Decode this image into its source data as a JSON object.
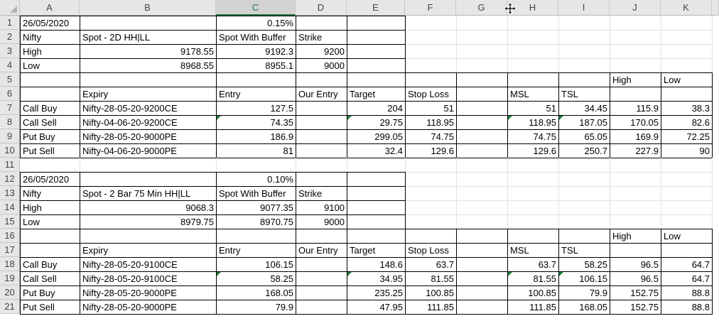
{
  "sheet": {
    "columns": [
      "A",
      "B",
      "C",
      "D",
      "E",
      "F",
      "G",
      "H",
      "I",
      "J",
      "K"
    ],
    "selected_column": "C",
    "rows": [
      "1",
      "2",
      "3",
      "4",
      "5",
      "6",
      "7",
      "8",
      "9",
      "10",
      "11",
      "12",
      "13",
      "14",
      "15",
      "16",
      "17",
      "18",
      "19",
      "20",
      "21"
    ]
  },
  "cells": {
    "A1": "26/05/2020",
    "C1": "0.15%",
    "A2": "Nifty",
    "B2": "Spot -  2D HH|LL",
    "C2": "Spot With Buffer",
    "D2": "Strike",
    "A3": "High",
    "B3": "9178.55",
    "C3": "9192.3",
    "D3": "9200",
    "A4": "Low",
    "B4": "8968.55",
    "C4": "8955.1",
    "D4": "9000",
    "J5": "High",
    "K5": "Low",
    "B6": "Expiry",
    "C6": "Entry",
    "D6": "Our Entry",
    "E6": "Target",
    "F6": "Stop Loss",
    "H6": "MSL",
    "I6": "TSL",
    "A7": "Call Buy",
    "B7": "Nifty-28-05-20-9200CE",
    "C7": "127.5",
    "E7": "204",
    "F7": "51",
    "H7": "51",
    "I7": "34.45",
    "J7": "115.9",
    "K7": "38.3",
    "A8": "Call Sell",
    "B8": "Nifty-04-06-20-9200CE",
    "C8": "74.35",
    "E8": "29.75",
    "F8": "118.95",
    "H8": "118.95",
    "I8": "187.05",
    "J8": "170.05",
    "K8": "82.6",
    "A9": "Put Buy",
    "B9": "Nifty-28-05-20-9000PE",
    "C9": "186.9",
    "E9": "299.05",
    "F9": "74.75",
    "H9": "74.75",
    "I9": "65.05",
    "J9": "169.9",
    "K9": "72.25",
    "A10": "Put Sell",
    "B10": "Nifty-04-06-20-9000PE",
    "C10": "81",
    "E10": "32.4",
    "F10": "129.6",
    "H10": "129.6",
    "I10": "250.7",
    "J10": "227.9",
    "K10": "90",
    "A12": "26/05/2020",
    "C12": "0.10%",
    "A13": "Nifty",
    "B13": "Spot -  2 Bar 75 Min HH|LL",
    "C13": "Spot With Buffer",
    "D13": "Strike",
    "A14": "High",
    "B14": "9068.3",
    "C14": "9077.35",
    "D14": "9100",
    "A15": "Low",
    "B15": "8979.75",
    "C15": "8970.75",
    "D15": "9000",
    "J16": "High",
    "K16": "Low",
    "B17": "Expiry",
    "C17": "Entry",
    "D17": "Our Entry",
    "E17": "Target",
    "F17": "Stop Loss",
    "H17": "MSL",
    "I17": "TSL",
    "A18": "Call Buy",
    "B18": "Nifty-28-05-20-9100CE",
    "C18": "106.15",
    "E18": "148.6",
    "F18": "63.7",
    "H18": "63.7",
    "I18": "58.25",
    "J18": "96.5",
    "K18": "64.7",
    "A19": "Call Sell",
    "B19": "Nifty-28-05-20-9100CE",
    "C19": "58.25",
    "E19": "34.95",
    "F19": "81.55",
    "H19": "81.55",
    "I19": "106.15",
    "J19": "96.5",
    "K19": "64.7",
    "A20": "Put Buy",
    "B20": "Nifty-28-05-20-9000PE",
    "C20": "168.05",
    "E20": "235.25",
    "F20": "100.85",
    "H20": "100.85",
    "I20": "79.9",
    "J20": "152.75",
    "K20": "88.8",
    "A21": "Put Sell",
    "B21": "Nifty-28-05-20-9000PE",
    "C21": "79.9",
    "E21": "47.95",
    "F21": "111.85",
    "H21": "111.85",
    "I21": "168.05",
    "J21": "152.75",
    "K21": "88.8"
  },
  "icons": {
    "cursor": "move-cursor-icon",
    "corner": "select-all-icon"
  },
  "colors": {
    "header_bg": "#e6e6e6",
    "selected_header": "#217346",
    "gridline": "#e2e2e2",
    "error_flag": "#1e7b3c"
  }
}
